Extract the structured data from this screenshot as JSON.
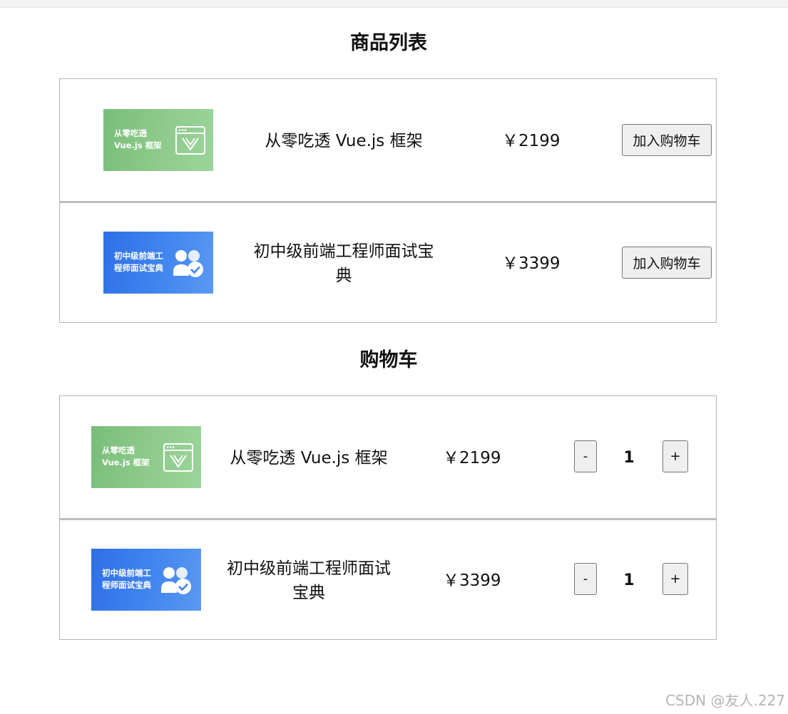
{
  "page": {
    "product_list_title": "商品列表",
    "cart_title": "购物车",
    "watermark": "CSDN @友人.227"
  },
  "products": [
    {
      "thumb_text": "从零吃透\nVue.js 框架",
      "thumb_color": "green",
      "name": "从零吃透 Vue.js 框架",
      "price": "￥2199",
      "button_label": "加入购物车"
    },
    {
      "thumb_text": "初中级前端工\n程师面试宝典",
      "thumb_color": "blue",
      "name": "初中级前端工程师面试宝典",
      "price": "￥3399",
      "button_label": "加入购物车"
    }
  ],
  "cart": [
    {
      "thumb_text": "从零吃透\nVue.js 框架",
      "name": "从零吃透 Vue.js 框架",
      "price": "￥2199",
      "minus_label": "-",
      "quantity": "1",
      "plus_label": "+"
    },
    {
      "thumb_text": "初中级前端工\n程师面试宝典",
      "name": "初中级前端工程师面试宝典",
      "price": "￥3399",
      "minus_label": "-",
      "quantity": "1",
      "plus_label": "+"
    }
  ],
  "icons": {
    "vue_course_icon": "browser-window-vue-icon",
    "interview_icon": "users-check-icon"
  },
  "colors": {
    "green_banner": "#7fc27f",
    "blue_banner": "#3a7eec",
    "border": "#b4b4b4"
  }
}
